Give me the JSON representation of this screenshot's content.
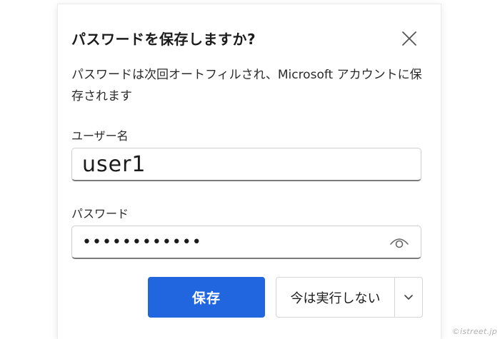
{
  "dialog": {
    "title": "パスワードを保存しますか?",
    "description": "パスワードは次回オートフィルされ、Microsoft アカウントに保存されます",
    "username_label": "ユーザー名",
    "username_value": "user1",
    "password_label": "パスワード",
    "password_value": "••••••••••••",
    "save_label": "保存",
    "not_now_label": "今は実行しない",
    "close_icon": "close-icon",
    "reveal_icon": "eye-icon",
    "more_icon": "chevron-down-icon"
  },
  "colors": {
    "primary": "#2166df",
    "text": "#1b1b1b"
  },
  "watermark": "©istreet.jp"
}
